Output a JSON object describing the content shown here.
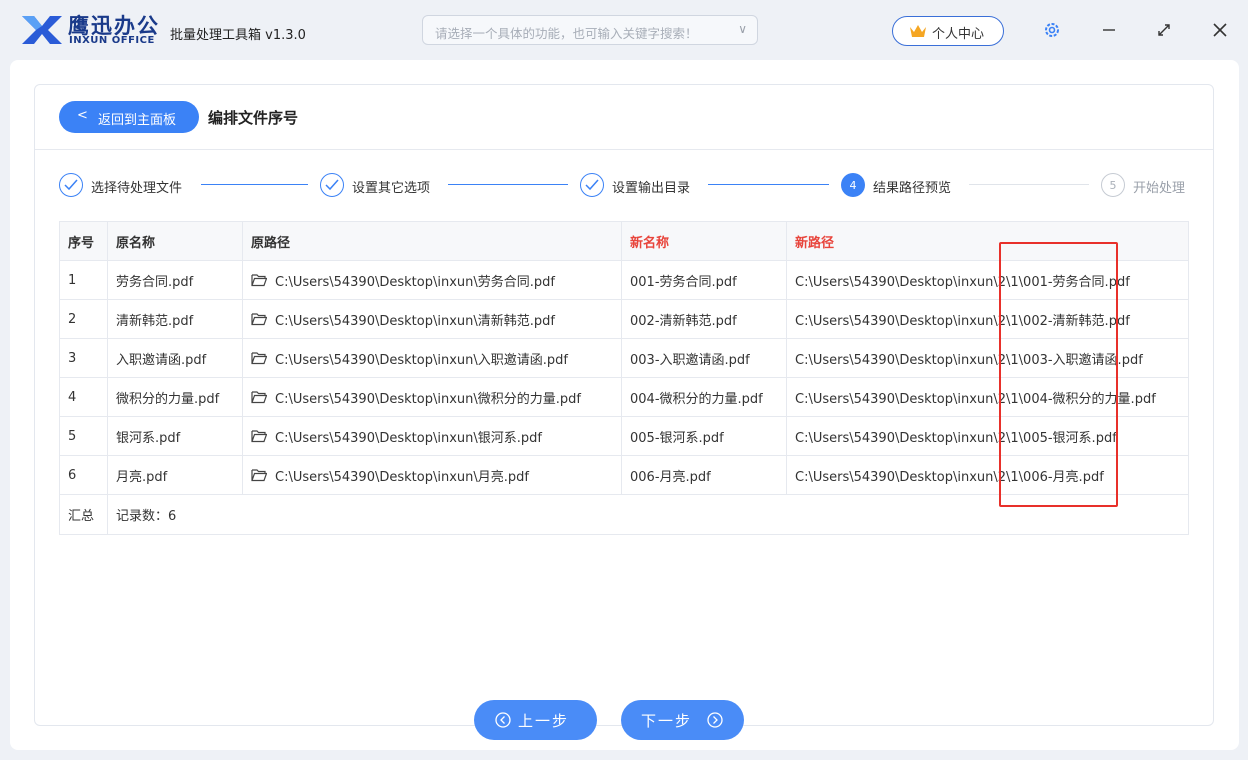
{
  "app": {
    "brand_cn": "鹰迅办公",
    "brand_en": "INXUN OFFICE",
    "title": "批量处理工具箱 v1.3.0",
    "search_placeholder": "请选择一个具体的功能，也可输入关键字搜索！",
    "user_center": "个人中心"
  },
  "page": {
    "back_label": "返回到主面板",
    "title": "编排文件序号"
  },
  "steps": [
    {
      "label": "选择待处理文件",
      "status": "done"
    },
    {
      "label": "设置其它选项",
      "status": "done"
    },
    {
      "label": "设置输出目录",
      "status": "done"
    },
    {
      "label": "结果路径预览",
      "status": "active",
      "number": "4"
    },
    {
      "label": "开始处理",
      "status": "todo",
      "number": "5"
    }
  ],
  "table": {
    "headers": [
      "序号",
      "原名称",
      "原路径",
      "新名称",
      "新路径"
    ],
    "rows": [
      {
        "idx": "1",
        "orig_name": "劳务合同.pdf",
        "orig_path": "C:\\Users\\54390\\Desktop\\inxun\\劳务合同.pdf",
        "new_name": "001-劳务合同.pdf",
        "new_path": "C:\\Users\\54390\\Desktop\\inxun\\2\\1\\001-劳务合同.pdf"
      },
      {
        "idx": "2",
        "orig_name": "清新韩范.pdf",
        "orig_path": "C:\\Users\\54390\\Desktop\\inxun\\清新韩范.pdf",
        "new_name": "002-清新韩范.pdf",
        "new_path": "C:\\Users\\54390\\Desktop\\inxun\\2\\1\\002-清新韩范.pdf"
      },
      {
        "idx": "3",
        "orig_name": "入职邀请函.pdf",
        "orig_path": "C:\\Users\\54390\\Desktop\\inxun\\入职邀请函.pdf",
        "new_name": "003-入职邀请函.pdf",
        "new_path": "C:\\Users\\54390\\Desktop\\inxun\\2\\1\\003-入职邀请函.pdf"
      },
      {
        "idx": "4",
        "orig_name": "微积分的力量.pdf",
        "orig_path": "C:\\Users\\54390\\Desktop\\inxun\\微积分的力量.pdf",
        "new_name": "004-微积分的力量.pdf",
        "new_path": "C:\\Users\\54390\\Desktop\\inxun\\2\\1\\004-微积分的力量.pdf"
      },
      {
        "idx": "5",
        "orig_name": "银河系.pdf",
        "orig_path": "C:\\Users\\54390\\Desktop\\inxun\\银河系.pdf",
        "new_name": "005-银河系.pdf",
        "new_path": "C:\\Users\\54390\\Desktop\\inxun\\2\\1\\005-银河系.pdf"
      },
      {
        "idx": "6",
        "orig_name": "月亮.pdf",
        "orig_path": "C:\\Users\\54390\\Desktop\\inxun\\月亮.pdf",
        "new_name": "006-月亮.pdf",
        "new_path": "C:\\Users\\54390\\Desktop\\inxun\\2\\1\\006-月亮.pdf"
      }
    ],
    "summary_label": "汇总",
    "summary_count": "记录数：6"
  },
  "nav": {
    "prev": "上一步",
    "next": "下一步"
  },
  "colors": {
    "accent": "#3b82f6",
    "new_header": "#e8453c",
    "highlight": "#e8302a"
  }
}
